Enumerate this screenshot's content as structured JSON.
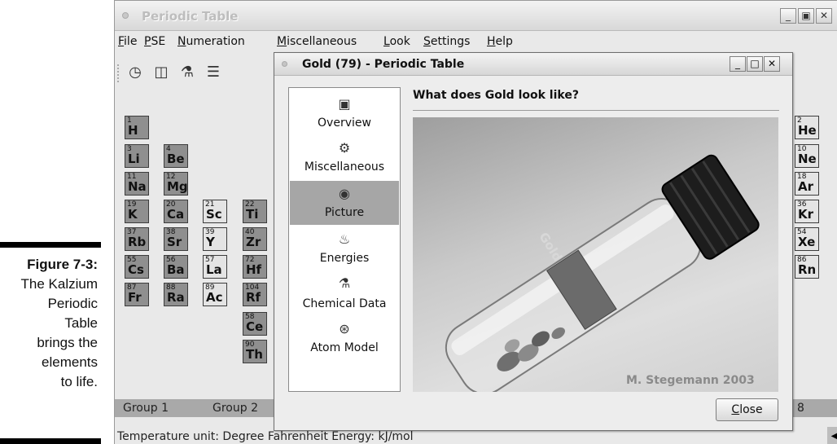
{
  "caption": {
    "label": "Figure 7-3:",
    "lines": [
      "The Kalzium",
      "Periodic",
      "Table",
      "brings the",
      "elements",
      "to life."
    ]
  },
  "main_window": {
    "title": "Periodic Table",
    "menu": [
      "File",
      "PSE",
      "Numeration",
      "Miscellaneous",
      "Look",
      "Settings",
      "Help"
    ],
    "toolbar_icons": [
      "clock-icon",
      "chart-icon",
      "flask-icon",
      "list-icon"
    ],
    "groups": [
      "Group 1",
      "Group 2",
      "8"
    ],
    "status": "Temperature unit: Degree Fahrenheit  Energy: kJ/mol"
  },
  "elements": [
    {
      "num": "1",
      "sym": "H"
    },
    {
      "num": "3",
      "sym": "Li"
    },
    {
      "num": "4",
      "sym": "Be"
    },
    {
      "num": "11",
      "sym": "Na"
    },
    {
      "num": "12",
      "sym": "Mg"
    },
    {
      "num": "19",
      "sym": "K"
    },
    {
      "num": "20",
      "sym": "Ca"
    },
    {
      "num": "21",
      "sym": "Sc"
    },
    {
      "num": "22",
      "sym": "Ti"
    },
    {
      "num": "37",
      "sym": "Rb"
    },
    {
      "num": "38",
      "sym": "Sr"
    },
    {
      "num": "39",
      "sym": "Y"
    },
    {
      "num": "40",
      "sym": "Zr"
    },
    {
      "num": "55",
      "sym": "Cs"
    },
    {
      "num": "56",
      "sym": "Ba"
    },
    {
      "num": "57",
      "sym": "La"
    },
    {
      "num": "72",
      "sym": "Hf"
    },
    {
      "num": "87",
      "sym": "Fr"
    },
    {
      "num": "88",
      "sym": "Ra"
    },
    {
      "num": "89",
      "sym": "Ac"
    },
    {
      "num": "104",
      "sym": "Rf"
    },
    {
      "num": "58",
      "sym": "Ce"
    },
    {
      "num": "90",
      "sym": "Th"
    },
    {
      "num": "2",
      "sym": "He"
    },
    {
      "num": "10",
      "sym": "Ne"
    },
    {
      "num": "18",
      "sym": "Ar"
    },
    {
      "num": "36",
      "sym": "Kr"
    },
    {
      "num": "54",
      "sym": "Xe"
    },
    {
      "num": "86",
      "sym": "Rn"
    }
  ],
  "dialog": {
    "title": "Gold (79) - Periodic Table",
    "heading": "What does Gold look like?",
    "sidebar": [
      {
        "label": "Overview",
        "icon": "overview-icon",
        "selected": false
      },
      {
        "label": "Miscellaneous",
        "icon": "gear-icon",
        "selected": false
      },
      {
        "label": "Picture",
        "icon": "eye-icon",
        "selected": true
      },
      {
        "label": "Energies",
        "icon": "flame-icon",
        "selected": false
      },
      {
        "label": "Chemical Data",
        "icon": "flask-icon",
        "selected": false
      },
      {
        "label": "Atom Model",
        "icon": "atom-icon",
        "selected": false
      }
    ],
    "photo_label": "Gold",
    "photo_credit": "M. Stegemann 2003",
    "close_label": "Close"
  }
}
